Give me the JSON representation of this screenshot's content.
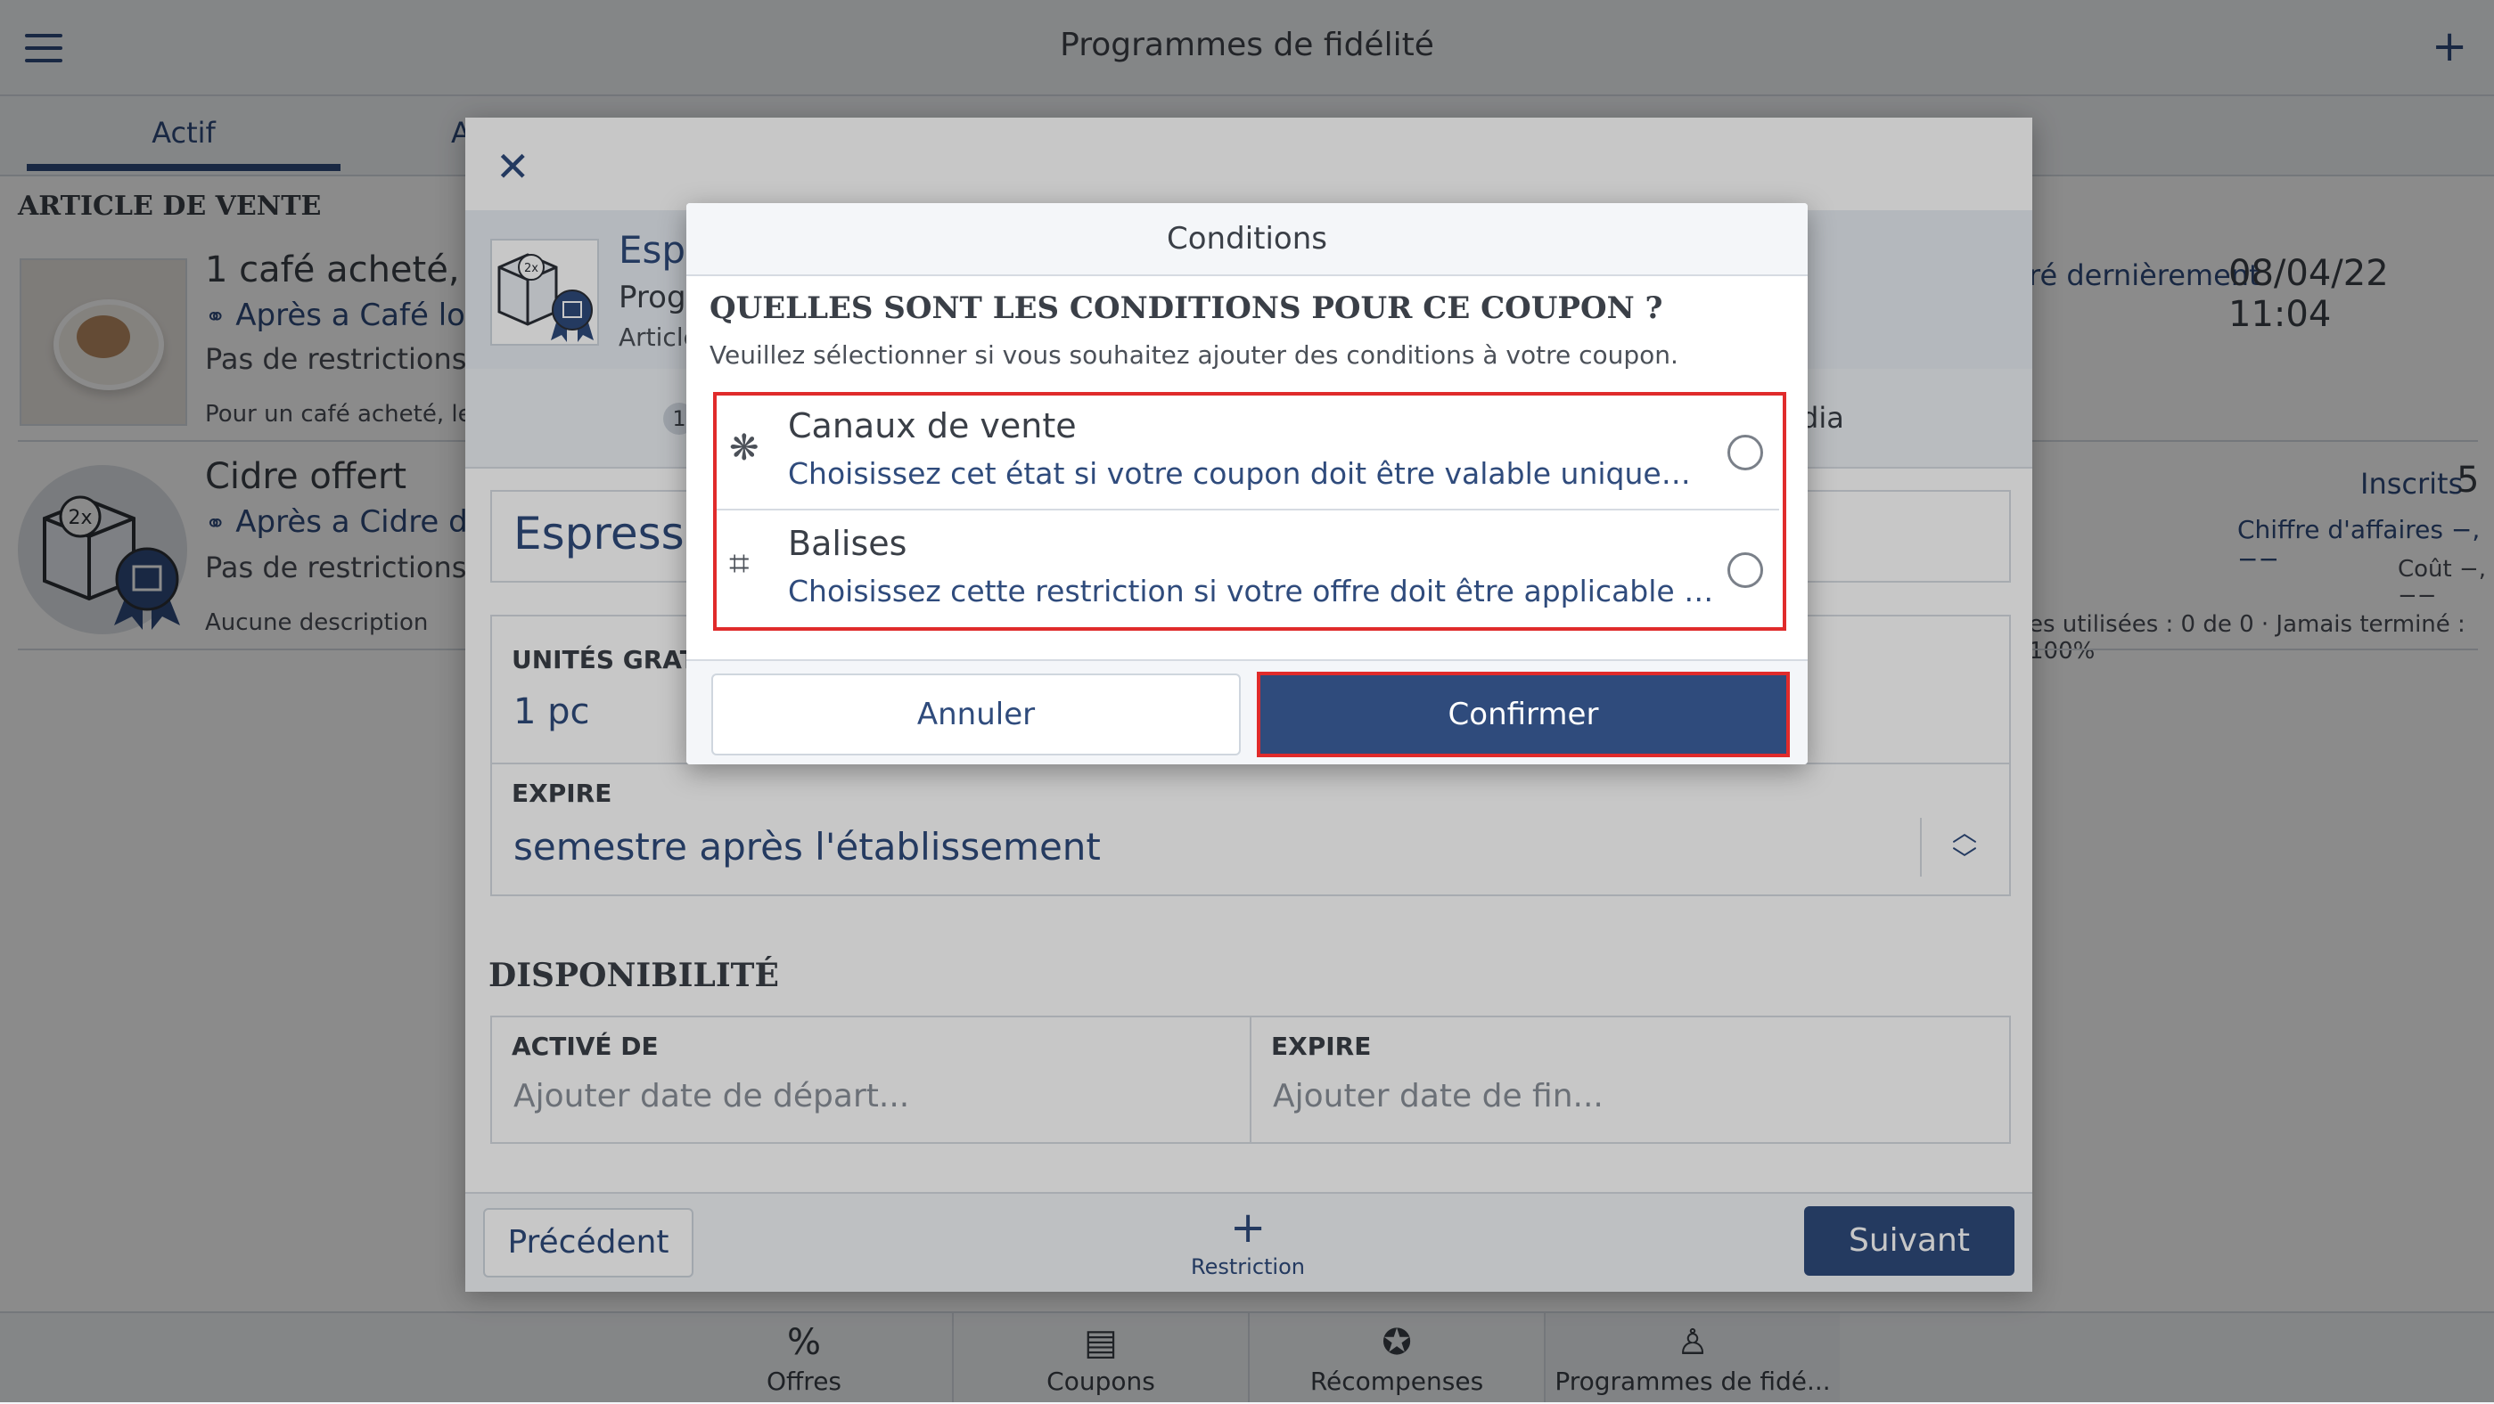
{
  "app": {
    "title": "Programmes de fidélité",
    "tabs": [
      "Actif",
      "A"
    ],
    "section_header": "ARTICLE DE VENTE"
  },
  "list": [
    {
      "title": "1 café acheté, 1 c",
      "trigger": "Après a Café long",
      "restrictions": "Pas de restrictions",
      "description": "Pour un café acheté, le de",
      "meta_label": "ré dernièrement",
      "meta_value": "08/04/22 11:04"
    },
    {
      "title": "Cidre offert",
      "trigger": "Après a Cidre dou",
      "restrictions": "Pas de restrictions",
      "description": "Aucune description",
      "badge_text": "2x",
      "inscrits_label": "Inscrits",
      "inscrits_value": "5",
      "ca_label": "Chiffre d'affaires −,−−",
      "cout_label": "Coût −,−−",
      "usage_label": "es utilisées : 0 de 0 · Jamais terminé :  100%"
    }
  ],
  "wizard": {
    "name_short": "Espr",
    "prog_short": "Prog",
    "article_short": "Article",
    "thumb_badge": "2x",
    "step_num": "1",
    "step_media": "dia",
    "name_value": "Espresso",
    "units_label": "UNITÉS GRATUIT",
    "units_value": "1 pc",
    "expire_label": "EXPIRE",
    "expire_value": "semestre après l'établissement",
    "dispo_header": "DISPONIBILITÉ",
    "active_label": "ACTIVÉ DE",
    "active_placeholder": "Ajouter date de départ...",
    "dexpire_label": "EXPIRE",
    "dexpire_placeholder": "Ajouter date de fin...",
    "prev_label": "Précédent",
    "restriction_label": "Restriction",
    "next_label": "Suivant"
  },
  "dialog": {
    "title": "Conditions",
    "question": "QUELLES SONT LES CONDITIONS POUR CE COUPON ?",
    "description": "Veuillez sélectionner si vous souhaitez ajouter des conditions à votre coupon.",
    "options": [
      {
        "icon": "network-icon",
        "title": "Canaux de vente",
        "desc": "Choisissez cet état si votre coupon doit être valable uniquement p...",
        "selected": false
      },
      {
        "icon": "tag-icon",
        "title": "Balises",
        "desc": "Choisissez cette restriction si votre offre doit être applicable uniqu...",
        "selected": false
      }
    ],
    "cancel_label": "Annuler",
    "confirm_label": "Confirmer",
    "highlight_color": "#e02b2b"
  },
  "bottom_tabs": [
    {
      "icon": "percent-badge-icon",
      "label": "Offres"
    },
    {
      "icon": "coupon-icon",
      "label": "Coupons"
    },
    {
      "icon": "award-icon",
      "label": "Récompenses"
    },
    {
      "icon": "person-badge-icon",
      "label": "Programmes de fidé..."
    }
  ],
  "colors": {
    "accent": "#2f4b7c",
    "highlight": "#e02b2b"
  }
}
